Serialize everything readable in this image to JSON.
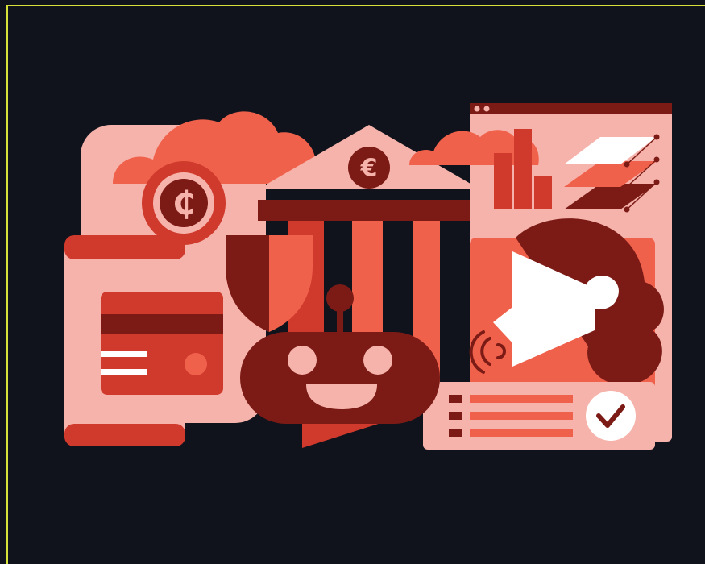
{
  "illustration": {
    "palette": {
      "background": "#10131c",
      "frame": "#d8e13a",
      "pale": "#f6b3ab",
      "coral": "#f0614b",
      "red": "#d03a2c",
      "dark_red": "#7c1b16",
      "white": "#ffffff"
    },
    "bank": {
      "currency_symbol": "€"
    },
    "coin": {
      "currency_symbol": "₵"
    },
    "robot": {
      "expression": "smiling"
    },
    "icons": [
      "cloud-icon",
      "bank-icon",
      "euro-coin-icon",
      "cedi-coin-icon",
      "smartphone-icon",
      "credit-card-icon",
      "shield-icon",
      "chatbot-icon",
      "megaphone-icon",
      "sound-waves-icon",
      "bar-chart-icon",
      "layers-icon",
      "checklist-icon",
      "checkmark-icon",
      "browser-window-icon"
    ]
  }
}
